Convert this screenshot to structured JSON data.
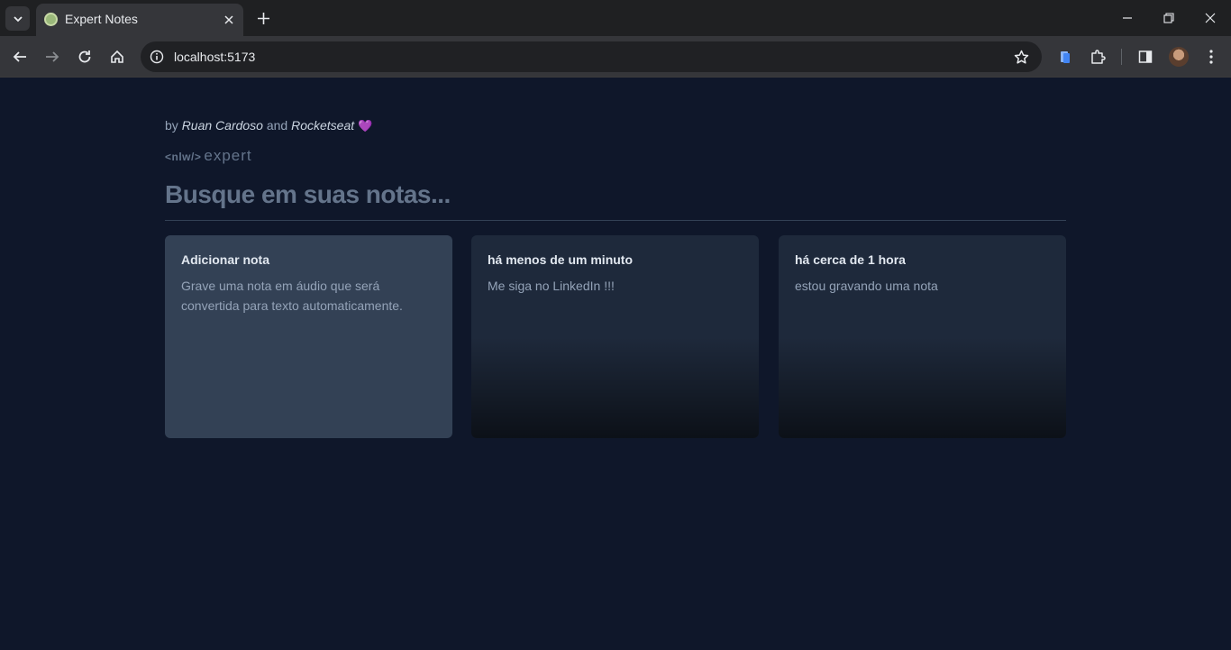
{
  "browser": {
    "tab_title": "Expert Notes",
    "url": "localhost:5173"
  },
  "header": {
    "by": "by",
    "author": "Ruan Cardoso",
    "and": "and",
    "org": "Rocketseat",
    "heart": "💜",
    "logo_nlw": "<nlw/>",
    "logo_expert": "expert"
  },
  "search": {
    "placeholder": "Busque em suas notas..."
  },
  "add_card": {
    "title": "Adicionar nota",
    "description": "Grave uma nota em áudio que será convertida para texto automaticamente."
  },
  "notes": [
    {
      "date": "há menos de um minuto",
      "content": "Me siga no LinkedIn !!!"
    },
    {
      "date": "há cerca de 1 hora",
      "content": "estou gravando uma nota"
    }
  ],
  "colors": {
    "background": "#0f172a",
    "card_add": "#334155",
    "card_note": "#1e293b",
    "heart": "#a855f7"
  }
}
